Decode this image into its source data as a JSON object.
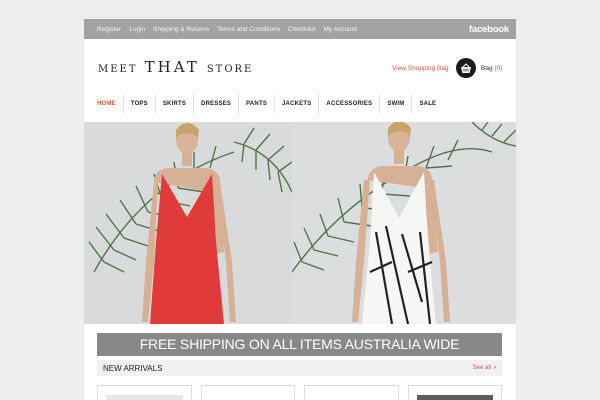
{
  "topbar": {
    "links": [
      "Register",
      "Login",
      "Shipping & Returns",
      "Terms and Conditions",
      "Checkout",
      "My Account"
    ],
    "social": "facebook"
  },
  "header": {
    "logo": {
      "word1": "MEET",
      "word2": "THAT",
      "word3": "STORE"
    },
    "view_bag": "View Shopping Bag",
    "bag_label": "Bag",
    "bag_count": "(0)",
    "bag_icon": "shopping-basket-icon"
  },
  "nav": {
    "items": [
      "HOME",
      "TOPS",
      "SKIRTS",
      "DRESSES",
      "PANTS",
      "JACKETS",
      "ACCESSORIES",
      "SWIM",
      "SALE"
    ],
    "active": "HOME"
  },
  "banner": "FREE SHIPPING ON ALL ITEMS AUSTRALIA WIDE",
  "arrivals": {
    "title": "NEW ARRIVALS",
    "see_all": "See all"
  },
  "colors": {
    "accent": "#d0593a",
    "topbar": "#a3a3a3",
    "banner": "#888888",
    "red_dress": "#e03a3a"
  }
}
